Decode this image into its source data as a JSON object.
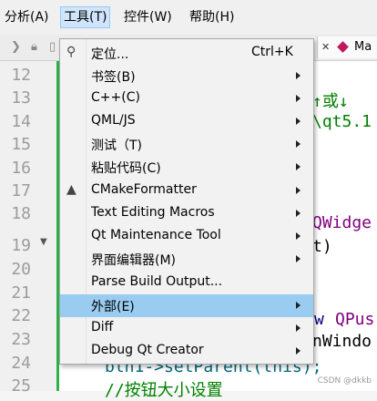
{
  "menubar": {
    "items": [
      {
        "label": "分析(A)"
      },
      {
        "label": "工具(T)"
      },
      {
        "label": "控件(W)"
      },
      {
        "label": "帮助(H)"
      }
    ]
  },
  "tab": {
    "close": "✕",
    "filename": "Ma"
  },
  "gutter": {
    "lines": [
      "12",
      "13",
      "14",
      "15",
      "16",
      "17",
      "18",
      "19",
      "20",
      "21",
      "22",
      "23",
      "24",
      "25"
    ]
  },
  "code": {
    "frag13": "↑或↓",
    "frag14": "\\qt5.1",
    "frag18": "QWidge",
    "frag19": "t)",
    "frag22a": "w ",
    "frag22b": "QPus",
    "frag23": "nWindo",
    "frag24": "btn1->setParent(this);",
    "frag25": "//按钮大小设置"
  },
  "watermark": "CSDN @dkkb",
  "menu": {
    "items": [
      {
        "label": "定位...",
        "shortcut": "Ctrl+K",
        "submenu": false,
        "icon": "search-icon"
      },
      {
        "label": "书签(B)",
        "shortcut": "",
        "submenu": true
      },
      {
        "label": "C++(C)",
        "shortcut": "",
        "submenu": true
      },
      {
        "label": "QML/JS",
        "shortcut": "",
        "submenu": true
      },
      {
        "label": "测试（T)",
        "shortcut": "",
        "submenu": true
      },
      {
        "label": "粘贴代码(C)",
        "shortcut": "",
        "submenu": true
      },
      {
        "label": "CMakeFormatter",
        "shortcut": "",
        "submenu": true,
        "icon": "cmake-icon"
      },
      {
        "label": "Text Editing Macros",
        "shortcut": "",
        "submenu": true
      },
      {
        "label": "Qt Maintenance Tool",
        "shortcut": "",
        "submenu": true
      },
      {
        "label": "界面编辑器(M)",
        "shortcut": "",
        "submenu": true
      },
      {
        "label": "Parse Build Output...",
        "shortcut": "",
        "submenu": false
      },
      {
        "label": "外部(E)",
        "shortcut": "",
        "submenu": true,
        "selected": true
      },
      {
        "label": "Diff",
        "shortcut": "",
        "submenu": true
      },
      {
        "label": "Debug Qt Creator",
        "shortcut": "",
        "submenu": true
      }
    ]
  },
  "colors": {
    "selected_item": "#99ccf0",
    "menu_bg": "#f2f2f2",
    "modified_bar": "#2db24a"
  }
}
